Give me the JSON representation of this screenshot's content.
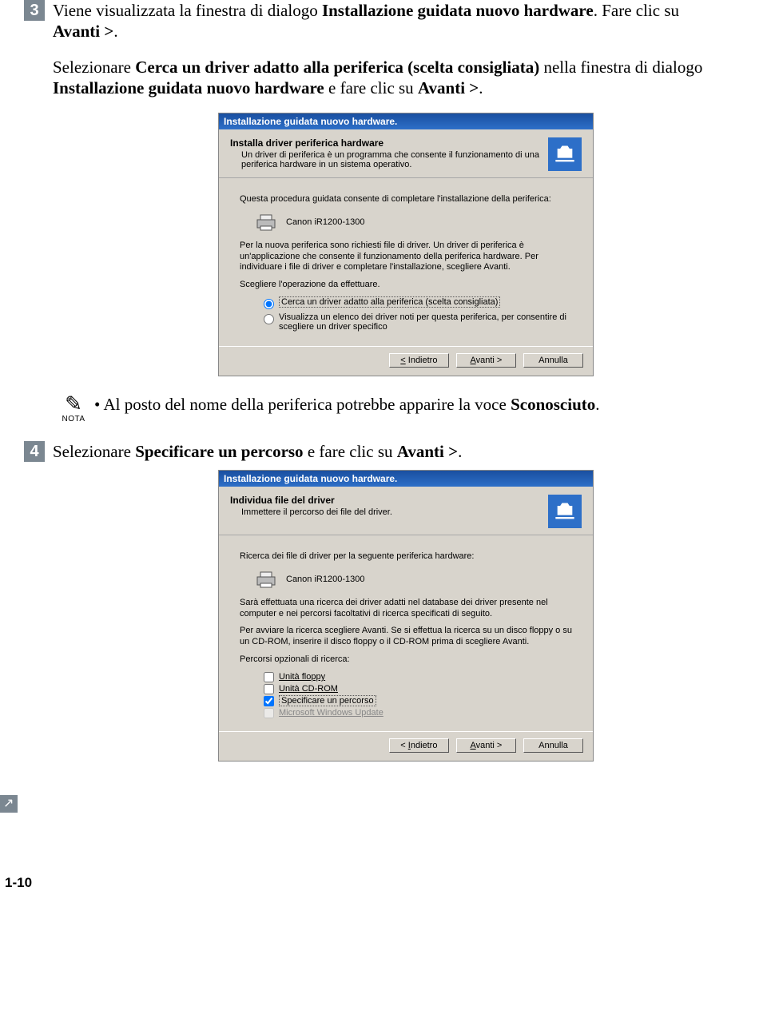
{
  "step3": {
    "num": "3",
    "text_a": "Viene visualizzata la finestra di dialogo ",
    "text_b": "Installazione guidata nuovo hardware",
    "text_c": ". Fare clic su ",
    "text_d": "Avanti >",
    "text_e": ".",
    "para_a": "Selezionare ",
    "para_b": "Cerca un driver adatto alla periferica (scelta consigliata)",
    "para_c": " nella finestra di dialogo ",
    "para_d": "Installazione guidata nuovo hardware",
    "para_e": " e fare clic su ",
    "para_f": "Avanti >",
    "para_g": "."
  },
  "screenshot1": {
    "title": "Installazione guidata nuovo hardware.",
    "header_title": "Installa driver periferica hardware",
    "header_sub": "Un driver di periferica è un programma che consente il funzionamento di una periferica hardware in un sistema operativo.",
    "line1": "Questa procedura guidata consente di completare l'installazione della periferica:",
    "device": "Canon iR1200-1300",
    "line2": "Per la nuova periferica sono richiesti file di driver. Un driver di periferica è un'applicazione che consente il funzionamento della periferica hardware. Per individuare i file di driver e completare l'installazione, scegliere Avanti.",
    "line3": "Scegliere l'operazione da effettuare.",
    "radio1": "Cerca un driver adatto alla periferica (scelta consigliata)",
    "radio2": "Visualizza un elenco dei driver noti per questa periferica, per consentire di scegliere un driver specifico",
    "btn_back": "< Indietro",
    "btn_next": "Avanti >",
    "btn_cancel": "Annulla"
  },
  "note": {
    "label": "NOTA",
    "text_a": "Al posto del nome della periferica potrebbe apparire la voce ",
    "text_b": "Sconosciuto",
    "text_c": "."
  },
  "step4": {
    "num": "4",
    "text_a": "Selezionare ",
    "text_b": "Specificare un percorso",
    "text_c": " e fare clic su ",
    "text_d": "Avanti >",
    "text_e": "."
  },
  "screenshot2": {
    "title": "Installazione guidata nuovo hardware.",
    "header_title": "Individua file del driver",
    "header_sub": "Immettere il percorso dei file del driver.",
    "line1": "Ricerca dei file di driver per la seguente periferica hardware:",
    "device": "Canon iR1200-1300",
    "line2": "Sarà effettuata una ricerca dei driver adatti nel database dei driver presente nel computer e nei percorsi facoltativi di ricerca specificati di seguito.",
    "line3": "Per avviare la ricerca scegliere Avanti. Se si effettua la ricerca su un disco floppy o su un CD-ROM, inserire il disco floppy o il CD-ROM prima di scegliere Avanti.",
    "line4": "Percorsi opzionali di ricerca:",
    "check1": "Unità floppy",
    "check2": "Unità CD-ROM",
    "check3": "Specificare un percorso",
    "check4": "Microsoft Windows Update",
    "btn_back": "< Indietro",
    "btn_next": "Avanti >",
    "btn_cancel": "Annulla"
  },
  "pagenum": "1-10"
}
